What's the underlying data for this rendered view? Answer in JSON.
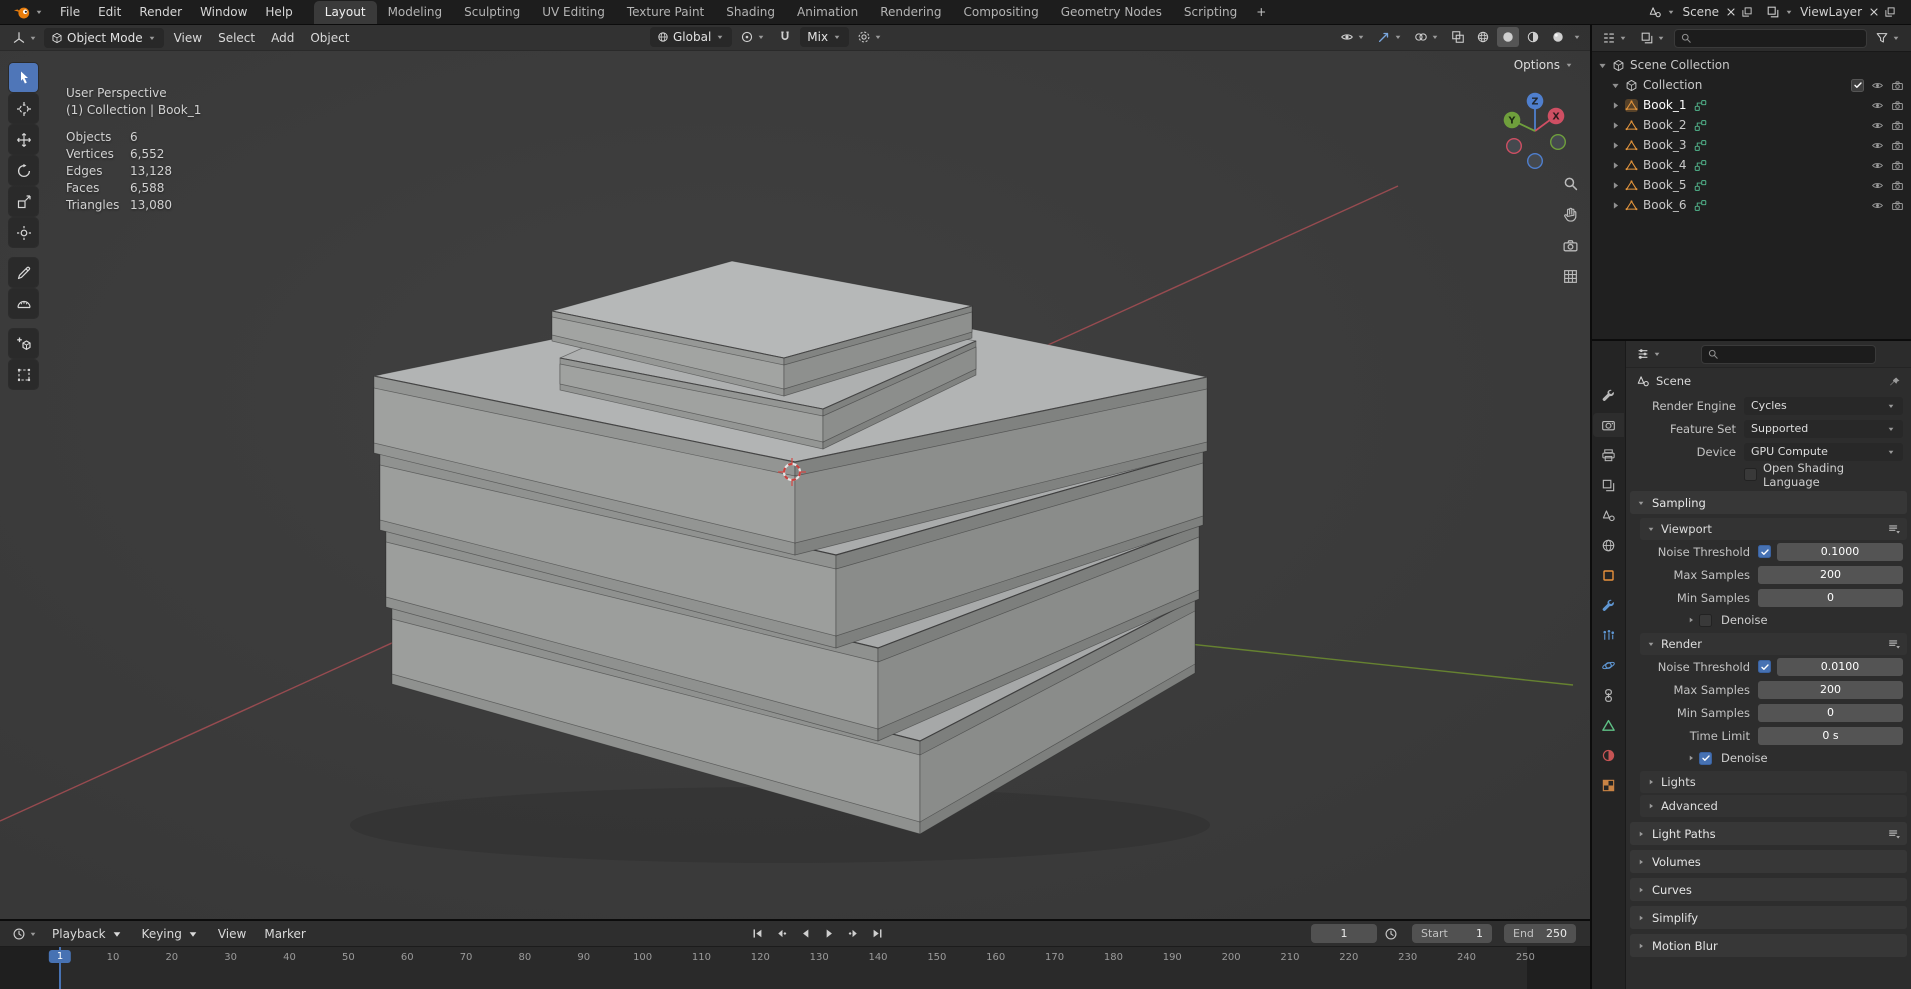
{
  "colors": {
    "accent": "#4772b3",
    "object_orange": "#e0933c",
    "axis_x": "#cf4f63",
    "axis_y": "#6f9f3c",
    "axis_z": "#4f7fce"
  },
  "topbar": {
    "app_menu": [
      "File",
      "Edit",
      "Render",
      "Window",
      "Help"
    ],
    "workspaces": [
      "Layout",
      "Modeling",
      "Sculpting",
      "UV Editing",
      "Texture Paint",
      "Shading",
      "Animation",
      "Rendering",
      "Compositing",
      "Geometry Nodes",
      "Scripting"
    ],
    "active_workspace": "Layout",
    "new_workspace_button": "+",
    "scene_selector": "Scene",
    "viewlayer_selector": "ViewLayer"
  },
  "viewport": {
    "header": {
      "mode": "Object Mode",
      "menus": [
        "View",
        "Select",
        "Add",
        "Object"
      ],
      "transform_orientation": "Global",
      "snap_target": "Mix",
      "options_button": "Options"
    },
    "tools": [
      {
        "name": "select-box",
        "icon": "t-select",
        "active": true
      },
      {
        "name": "cursor",
        "icon": "t-cursor"
      },
      {
        "name": "move",
        "icon": "t-move"
      },
      {
        "name": "rotate",
        "icon": "t-rotate"
      },
      {
        "name": "scale",
        "icon": "t-scale"
      },
      {
        "name": "transform",
        "icon": "t-transform"
      },
      {
        "name": "annotate",
        "icon": "t-annotate"
      },
      {
        "name": "measure",
        "icon": "t-measure"
      },
      {
        "name": "add-cube",
        "icon": "t-addcube"
      },
      {
        "name": "scale-cage",
        "icon": "t-cage"
      }
    ],
    "nav_icons": [
      {
        "name": "zoom",
        "icon": "search"
      },
      {
        "name": "pan",
        "icon": "hand"
      },
      {
        "name": "camera-view",
        "icon": "camera"
      },
      {
        "name": "orthographic-grid",
        "icon": "grid"
      }
    ],
    "overlay": {
      "title": "User Perspective",
      "subtitle": "(1) Collection | Book_1",
      "stats": [
        {
          "label": "Objects",
          "value": "6"
        },
        {
          "label": "Vertices",
          "value": "6,552"
        },
        {
          "label": "Edges",
          "value": "13,128"
        },
        {
          "label": "Faces",
          "value": "6,588"
        },
        {
          "label": "Triangles",
          "value": "13,080"
        }
      ]
    },
    "axis_gizmo": {
      "x": "X",
      "y": "Y",
      "z": "Z"
    }
  },
  "outliner": {
    "root": "Scene Collection",
    "collection": {
      "label": "Collection",
      "checked": true
    },
    "books": [
      {
        "label": "Book_1",
        "active": true
      },
      {
        "label": "Book_2"
      },
      {
        "label": "Book_3"
      },
      {
        "label": "Book_4"
      },
      {
        "label": "Book_5"
      },
      {
        "label": "Book_6"
      }
    ]
  },
  "properties": {
    "tabs": [
      {
        "name": "tool",
        "icon": "p-tool"
      },
      {
        "name": "render",
        "icon": "p-render",
        "active": true
      },
      {
        "name": "output",
        "icon": "p-output"
      },
      {
        "name": "view-layer",
        "icon": "p-vlayer"
      },
      {
        "name": "scene",
        "icon": "p-scene"
      },
      {
        "name": "world",
        "icon": "p-world"
      },
      {
        "name": "object",
        "icon": "p-object",
        "color": "#e8913c"
      },
      {
        "name": "modifiers",
        "icon": "p-mod",
        "color": "#5f96d2"
      },
      {
        "name": "particles",
        "icon": "p-part",
        "color": "#5f96d2"
      },
      {
        "name": "physics",
        "icon": "p-phys",
        "color": "#5f96d2"
      },
      {
        "name": "constraints",
        "icon": "p-constr"
      },
      {
        "name": "object-data",
        "icon": "p-data",
        "color": "#5fc186"
      },
      {
        "name": "material",
        "icon": "p-mat",
        "color": "#c65454"
      },
      {
        "name": "texture",
        "icon": "p-tex",
        "color": "#c98344"
      }
    ],
    "breadcrumb": "Scene",
    "render_engine": {
      "label": "Render Engine",
      "value": "Cycles"
    },
    "feature_set": {
      "label": "Feature Set",
      "value": "Supported"
    },
    "device": {
      "label": "Device",
      "value": "GPU Compute"
    },
    "osl": {
      "label": "Open Shading Language",
      "checked": false
    },
    "sampling": {
      "title": "Sampling",
      "viewport": {
        "title": "Viewport",
        "rows": [
          {
            "label": "Noise Threshold",
            "value": "0.1000",
            "checkbox": true,
            "checked": true
          },
          {
            "label": "Max Samples",
            "value": "200"
          },
          {
            "label": "Min Samples",
            "value": "0"
          }
        ],
        "denoise": {
          "label": "Denoise",
          "checked": false
        }
      },
      "render": {
        "title": "Render",
        "rows": [
          {
            "label": "Noise Threshold",
            "value": "0.0100",
            "checkbox": true,
            "checked": true
          },
          {
            "label": "Max Samples",
            "value": "200"
          },
          {
            "label": "Min Samples",
            "value": "0"
          },
          {
            "label": "Time Limit",
            "value": "0 s"
          }
        ],
        "denoise": {
          "label": "Denoise",
          "checked": true
        }
      },
      "lights": "Lights",
      "advanced": "Advanced"
    },
    "sections": [
      {
        "label": "Light Paths",
        "preset": true
      },
      {
        "label": "Volumes"
      },
      {
        "label": "Curves"
      },
      {
        "label": "Simplify"
      },
      {
        "label": "Motion Blur"
      }
    ]
  },
  "timeline": {
    "menus": [
      {
        "label": "Playback",
        "caret": true
      },
      {
        "label": "Keying",
        "caret": true
      },
      {
        "label": "View"
      },
      {
        "label": "Marker"
      }
    ],
    "playback_buttons": [
      {
        "name": "jump-to-start",
        "icon": "pb-first"
      },
      {
        "name": "previous-keyframe",
        "icon": "pb-prevkey"
      },
      {
        "name": "play-reverse",
        "icon": "pb-revplay"
      },
      {
        "name": "play",
        "icon": "pb-play"
      },
      {
        "name": "next-keyframe",
        "icon": "pb-nextkey"
      },
      {
        "name": "jump-to-end",
        "icon": "pb-last"
      }
    ],
    "current_frame": "1",
    "start_label": "Start",
    "start_value": "1",
    "end_label": "End",
    "end_value": "250",
    "ticks": [
      "10",
      "20",
      "30",
      "40",
      "50",
      "60",
      "70",
      "80",
      "90",
      "100",
      "110",
      "120",
      "130",
      "140",
      "150",
      "160",
      "170",
      "180",
      "190",
      "200",
      "210",
      "220",
      "230",
      "240",
      "250"
    ]
  }
}
